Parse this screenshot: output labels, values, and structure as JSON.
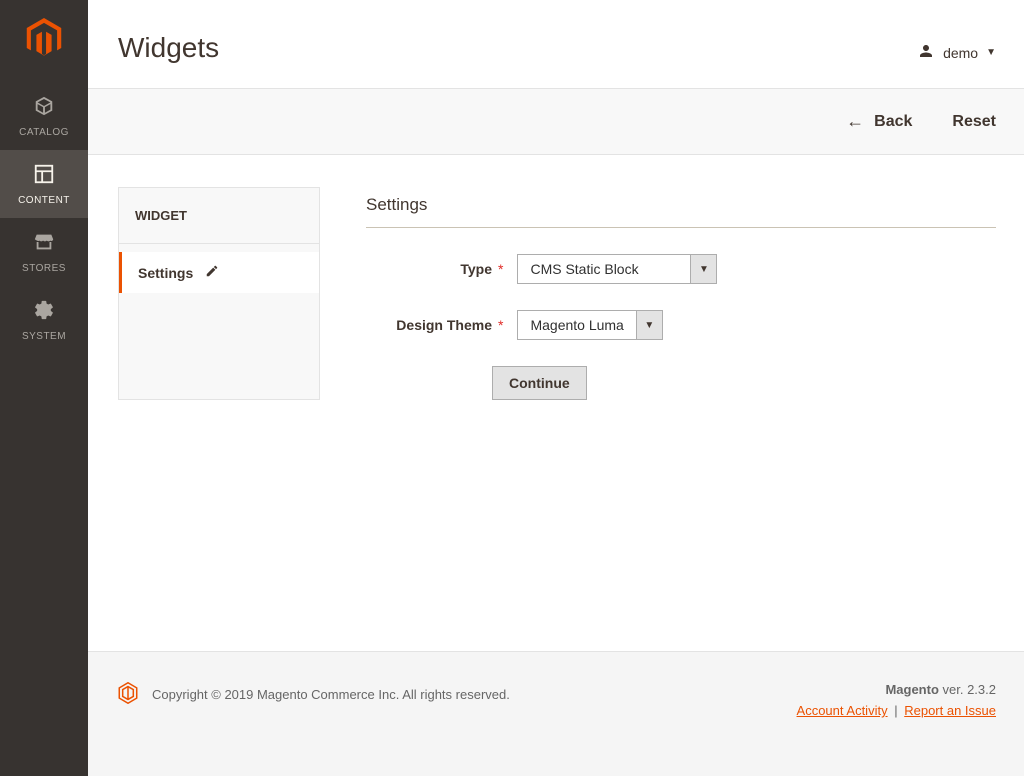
{
  "sidebar": {
    "items": [
      {
        "label": "CATALOG"
      },
      {
        "label": "CONTENT"
      },
      {
        "label": "STORES"
      },
      {
        "label": "SYSTEM"
      }
    ]
  },
  "header": {
    "title": "Widgets",
    "user": "demo"
  },
  "actions": {
    "back": "Back",
    "reset": "Reset"
  },
  "panel": {
    "header": "WIDGET",
    "item": "Settings"
  },
  "form": {
    "section_title": "Settings",
    "type_label": "Type",
    "type_value": "CMS Static Block",
    "theme_label": "Design Theme",
    "theme_value": "Magento Luma",
    "continue": "Continue"
  },
  "footer": {
    "copyright": "Copyright © 2019 Magento Commerce Inc. All rights reserved.",
    "brand": "Magento",
    "version_prefix": " ver. ",
    "version": "2.3.2",
    "activity": "Account Activity",
    "report": "Report an Issue"
  }
}
